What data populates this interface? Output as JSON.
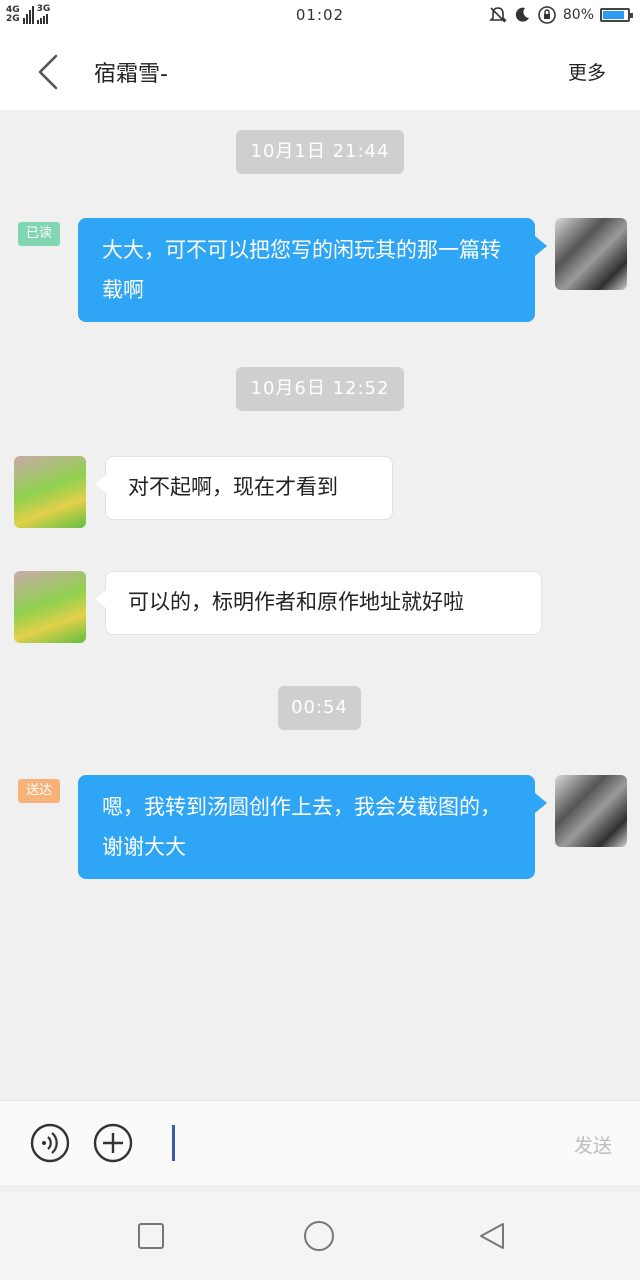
{
  "status_bar": {
    "network_top": "4G",
    "network_bottom": "2G",
    "network_3g": "3G",
    "time": "01:02",
    "battery": "80%",
    "battery_level": 0.8
  },
  "header": {
    "title": "宿霜雪-",
    "more_label": "更多"
  },
  "messages": [
    {
      "type": "time",
      "text": "10月1日 21:44"
    },
    {
      "type": "outgoing",
      "status": "已读",
      "text": "大大，可不可以把您写的闲玩其的那一篇转载啊"
    },
    {
      "type": "time",
      "text": "10月6日 12:52"
    },
    {
      "type": "incoming",
      "text": "对不起啊，现在才看到"
    },
    {
      "type": "incoming",
      "text": "可以的，标明作者和原作地址就好啦"
    },
    {
      "type": "time",
      "text": "00:54"
    },
    {
      "type": "outgoing",
      "status": "送达",
      "text": "嗯，我转到汤圆创作上去，我会发截图的，谢谢大大"
    }
  ],
  "input_bar": {
    "send_label": "发送"
  },
  "colors": {
    "outgoing_bubble": "#2fa5f5",
    "read_badge": "#7fd6b0",
    "sent_badge": "#f7b27a",
    "time_chip": "#cfcfcf"
  },
  "icons": [
    "voice-icon",
    "plus-icon",
    "back-icon",
    "recent-apps-icon",
    "home-icon",
    "nav-back-icon",
    "mute-icon",
    "moon-icon",
    "rotation-lock-icon",
    "battery-icon"
  ]
}
